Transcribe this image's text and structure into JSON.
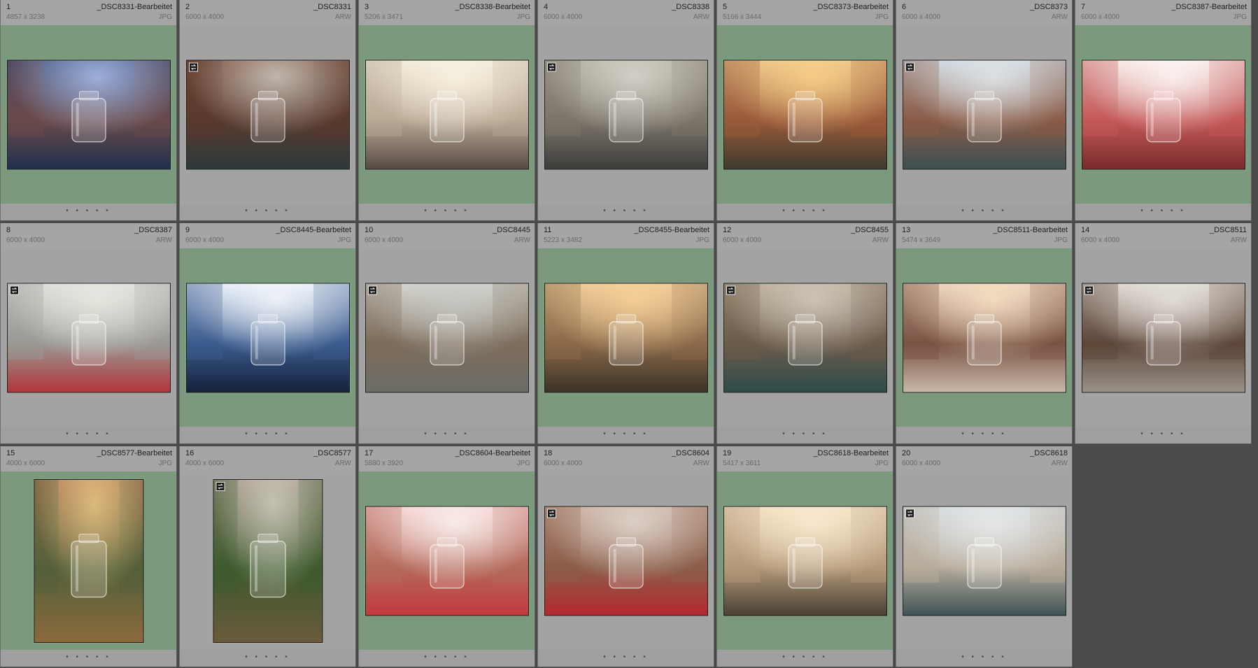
{
  "filmstrip": {
    "photos": [
      {
        "index": "1",
        "filename": "_DSC8331-Bearbeitet",
        "dimensions": "4857 x 3238",
        "type": "JPG",
        "picked": true,
        "orientation": "landscape",
        "virtual_copy": false,
        "scene": "bridge-blue-sparkle",
        "dots": "• • • • •"
      },
      {
        "index": "2",
        "filename": "_DSC8331",
        "dimensions": "6000 x 4000",
        "type": "ARW",
        "picked": false,
        "orientation": "landscape",
        "virtual_copy": true,
        "scene": "bridge-wall",
        "dots": "• • • • •"
      },
      {
        "index": "3",
        "filename": "_DSC8338-Bearbeitet",
        "dimensions": "5206 x 3471",
        "type": "JPG",
        "picked": true,
        "orientation": "landscape",
        "virtual_copy": false,
        "scene": "cork-sunlit-street",
        "dots": "• • • • •"
      },
      {
        "index": "4",
        "filename": "_DSC8338",
        "dimensions": "6000 x 4000",
        "type": "ARW",
        "picked": false,
        "orientation": "landscape",
        "virtual_copy": true,
        "scene": "cork-street",
        "dots": "• • • • •"
      },
      {
        "index": "5",
        "filename": "_DSC8373-Bearbeitet",
        "dimensions": "5166 x 3444",
        "type": "JPG",
        "picked": true,
        "orientation": "landscape",
        "virtual_copy": false,
        "scene": "canal-warm",
        "dots": "• • • • •"
      },
      {
        "index": "6",
        "filename": "_DSC8373",
        "dimensions": "6000 x 4000",
        "type": "ARW",
        "picked": false,
        "orientation": "landscape",
        "virtual_copy": true,
        "scene": "canal",
        "dots": "• • • • •"
      },
      {
        "index": "7",
        "filename": "_DSC8387-Bearbeitet",
        "dimensions": "6000 x 4000",
        "type": "JPG",
        "picked": true,
        "orientation": "landscape",
        "virtual_copy": false,
        "scene": "red-bench-bright",
        "dots": "• • • • •"
      },
      {
        "index": "8",
        "filename": "_DSC8387",
        "dimensions": "6000 x 4000",
        "type": "ARW",
        "picked": false,
        "orientation": "landscape",
        "virtual_copy": true,
        "scene": "red-bench",
        "dots": "• • • • •"
      },
      {
        "index": "9",
        "filename": "_DSC8445-Bearbeitet",
        "dimensions": "6000 x 4000",
        "type": "JPG",
        "picked": true,
        "orientation": "landscape",
        "virtual_copy": false,
        "scene": "blue-glow",
        "dots": "• • • • •"
      },
      {
        "index": "10",
        "filename": "_DSC8445",
        "dimensions": "6000 x 4000",
        "type": "ARW",
        "picked": false,
        "orientation": "landscape",
        "virtual_copy": true,
        "scene": "stone-street",
        "dots": "• • • • •"
      },
      {
        "index": "11",
        "filename": "_DSC8455-Bearbeitet",
        "dimensions": "5223 x 3482",
        "type": "JPG",
        "picked": true,
        "orientation": "landscape",
        "virtual_copy": false,
        "scene": "alley-warm",
        "dots": "• • • • •"
      },
      {
        "index": "12",
        "filename": "_DSC8455",
        "dimensions": "6000 x 4000",
        "type": "ARW",
        "picked": false,
        "orientation": "landscape",
        "virtual_copy": true,
        "scene": "alley-canal",
        "dots": "• • • • •"
      },
      {
        "index": "13",
        "filename": "_DSC8511-Bearbeitet",
        "dimensions": "5474 x 3649",
        "type": "JPG",
        "picked": true,
        "orientation": "landscape",
        "virtual_copy": false,
        "scene": "railing-warm",
        "dots": "• • • • •"
      },
      {
        "index": "14",
        "filename": "_DSC8511",
        "dimensions": "6000 x 4000",
        "type": "ARW",
        "picked": false,
        "orientation": "landscape",
        "virtual_copy": true,
        "scene": "railing",
        "dots": "• • • • •"
      },
      {
        "index": "15",
        "filename": "_DSC8577-Bearbeitet",
        "dimensions": "4000 x 6000",
        "type": "JPG",
        "picked": true,
        "orientation": "portrait",
        "virtual_copy": false,
        "scene": "ivy-warm",
        "dots": "• • • • •"
      },
      {
        "index": "16",
        "filename": "_DSC8577",
        "dimensions": "4000 x 6000",
        "type": "ARW",
        "picked": false,
        "orientation": "portrait",
        "virtual_copy": true,
        "scene": "ivy",
        "dots": "• • • • •"
      },
      {
        "index": "17",
        "filename": "_DSC8604-Bearbeitet",
        "dimensions": "5880 x 3920",
        "type": "JPG",
        "picked": true,
        "orientation": "landscape",
        "virtual_copy": false,
        "scene": "red-boat-pink",
        "dots": "• • • • •"
      },
      {
        "index": "18",
        "filename": "_DSC8604",
        "dimensions": "6000 x 4000",
        "type": "ARW",
        "picked": false,
        "orientation": "landscape",
        "virtual_copy": true,
        "scene": "red-boat",
        "dots": "• • • • •"
      },
      {
        "index": "19",
        "filename": "_DSC8618-Bearbeitet",
        "dimensions": "5417 x 3611",
        "type": "JPG",
        "picked": true,
        "orientation": "landscape",
        "virtual_copy": false,
        "scene": "palazzo-warm",
        "dots": "• • • • •"
      },
      {
        "index": "20",
        "filename": "_DSC8618",
        "dimensions": "6000 x 4000",
        "type": "ARW",
        "picked": false,
        "orientation": "landscape",
        "virtual_copy": true,
        "scene": "palazzo",
        "dots": "• • • • •"
      }
    ]
  },
  "colors": {
    "picked_background": "#7b9a7d",
    "cell_background": "#a3a3a3",
    "empty_background": "#4a4a4a"
  },
  "icons": {
    "virtual_copy": "virtual-copy-icon"
  }
}
